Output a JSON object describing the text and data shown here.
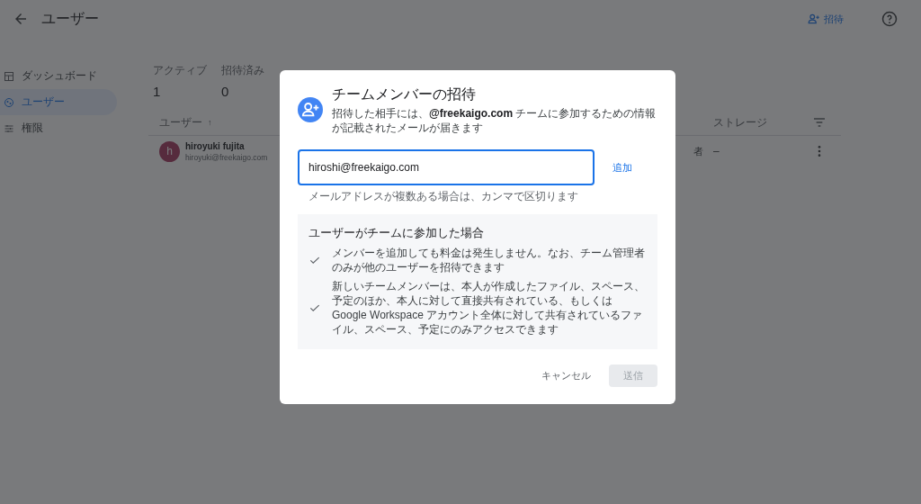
{
  "app_bar": {
    "title": "ユーザー",
    "invite_label": "招待"
  },
  "sidebar": {
    "items": [
      {
        "label": "ダッシュボード",
        "selected": false
      },
      {
        "label": "ユーザー",
        "selected": true
      },
      {
        "label": "権限",
        "selected": false
      }
    ]
  },
  "stats": [
    {
      "label": "アクティブ",
      "value": "1"
    },
    {
      "label": "招待済み",
      "value": "0"
    }
  ],
  "table": {
    "columns": [
      {
        "label": "ユーザー",
        "sort_indicator": "↑"
      },
      {
        "label": "ストレージ"
      }
    ],
    "rows": [
      {
        "avatar": "h",
        "name": "hiroyuki fujita",
        "email": "hiroyuki@freekaigo.com",
        "column_3": "者",
        "storage": "–"
      }
    ]
  },
  "dialog": {
    "title": "チームメンバーの招待",
    "description": "招待した相手には、**@freekaigo.com** チームに参加するための情報が記載されたメールが届きます",
    "input": {
      "value": "hiroshi@freekaigo.com",
      "focused": true
    },
    "add_label": "追加",
    "hint": "メールアドレスが複数ある場合は、カンマで区切ります",
    "info": {
      "heading": "ユーザーがチームに参加した場合",
      "items": [
        "メンバーを追加しても料金は発生しません。なお、チーム管理者のみが他のユーザーを招待できます",
        "新しいチームメンバーは、本人が作成したファイル、スペース、予定のほか、本人に対して直接共有されている、もしくは Google Workspace アカウント全体に対して共有されているファイル、スペース、予定にのみアクセスできます"
      ]
    },
    "buttons": [
      {
        "label": "キャンセル",
        "kind": "text",
        "disabled": false
      },
      {
        "label": "送信",
        "kind": "filled",
        "disabled": true
      }
    ]
  }
}
